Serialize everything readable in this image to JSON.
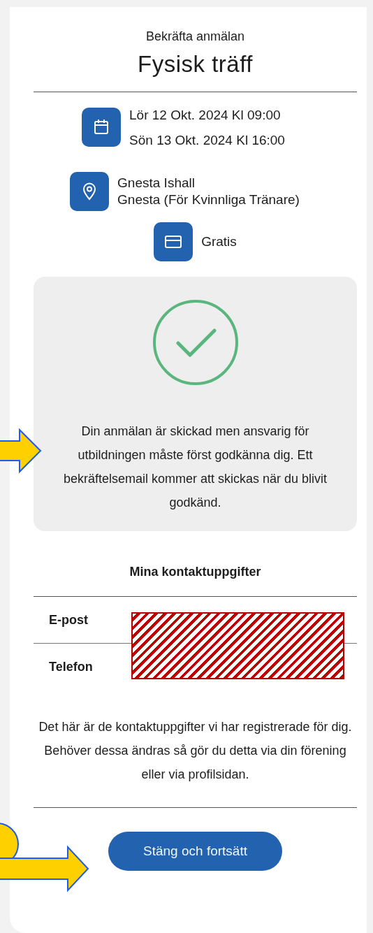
{
  "dialog": {
    "subtitle": "Bekräfta anmälan",
    "title": "Fysisk träff",
    "details": [
      {
        "kind": "date",
        "lines": [
          "Lör 12 Okt. 2024 Kl 09:00",
          "Sön 13 Okt. 2024 Kl 16:00"
        ]
      },
      {
        "kind": "location",
        "lines": [
          "Gnesta Ishall",
          "Gnesta (För Kvinnliga Tränare)"
        ]
      },
      {
        "kind": "price",
        "lines": [
          "Gratis"
        ]
      }
    ],
    "confirmation": {
      "message": "Din anmälan är skickad men ansvarig för utbildningen måste först godkänna dig. Ett bekräftelsemail kommer att skickas när du blivit godkänd."
    },
    "contact": {
      "heading": "Mina kontaktuppgifter",
      "rows": [
        {
          "label": "E-post"
        },
        {
          "label": "Telefon"
        }
      ],
      "note": "Det här är de kontaktuppgifter vi har registrerade för dig. Behöver dessa ändras så gör du detta via din förening eller via profilsidan."
    },
    "button": "Stäng och fortsätt"
  }
}
